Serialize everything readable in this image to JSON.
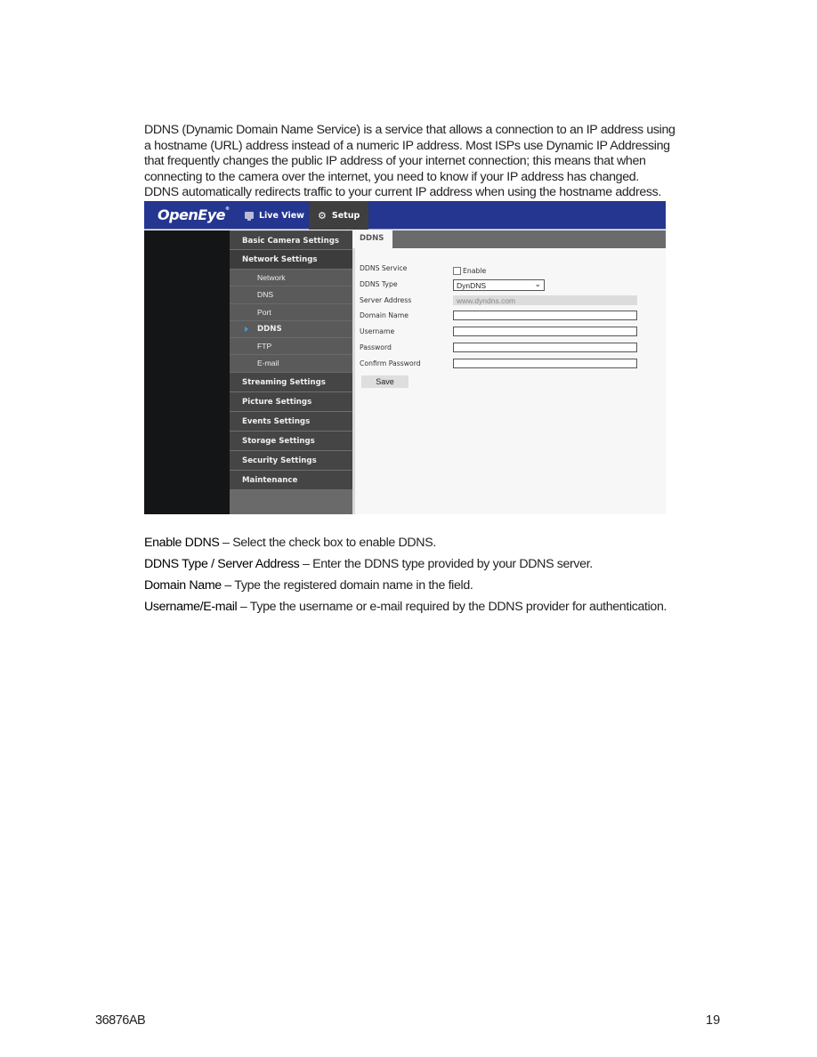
{
  "intro": {
    "lines": [
      "DDNS (Dynamic Domain Name Service) is a service that allows a connection to an IP address using",
      "a hostname (URL) address instead of a numeric IP address. Most ISPs use Dynamic IP Addressing",
      "that frequently changes the public IP address of your internet connection; this means that when",
      "connecting to the camera over the internet, you need to know if your IP address has changed.",
      "DDNS automatically redirects traffic to your current IP address when using the hostname address."
    ]
  },
  "screenshot": {
    "brand": "OpenEye",
    "brand_mark": "®",
    "colors": {
      "header": "#24368f",
      "active_tab": "#3f3f3f",
      "marker": "#3aa0e0"
    },
    "nav": [
      {
        "label": "Live View",
        "icon": "monitor-icon"
      },
      {
        "label": "Setup",
        "icon": "gear-icon",
        "active": true
      }
    ],
    "page_tab": "DDNS",
    "sidebar": {
      "sections": [
        {
          "label": "Basic Camera Settings"
        },
        {
          "label": "Network Settings",
          "expanded": true,
          "items": [
            {
              "label": "Network"
            },
            {
              "label": "DNS"
            },
            {
              "label": "Port"
            },
            {
              "label": "DDNS",
              "active": true
            },
            {
              "label": "FTP"
            },
            {
              "label": "E-mail"
            }
          ]
        },
        {
          "label": "Streaming Settings"
        },
        {
          "label": "Picture Settings"
        },
        {
          "label": "Events Settings"
        },
        {
          "label": "Storage Settings"
        },
        {
          "label": "Security Settings"
        },
        {
          "label": "Maintenance"
        }
      ]
    },
    "form": {
      "ddns_service": {
        "label": "DDNS Service",
        "checkbox_label": "Enable",
        "checked": false
      },
      "ddns_type": {
        "label": "DDNS Type",
        "value": "DynDNS"
      },
      "server_address": {
        "label": "Server Address",
        "value": "www.dyndns.com"
      },
      "domain_name": {
        "label": "Domain Name",
        "value": ""
      },
      "username": {
        "label": "Username",
        "value": ""
      },
      "password": {
        "label": "Password",
        "value": ""
      },
      "confirm_password": {
        "label": "Confirm Password",
        "value": ""
      },
      "save_label": "Save"
    }
  },
  "descriptions": [
    {
      "term": "Enable DDNS",
      "text": " – Select the check box to enable DDNS."
    },
    {
      "term": "DDNS Type / Server Address",
      "text": " – Enter the DDNS type provided by your DDNS server."
    },
    {
      "term": "Domain Name",
      "text": " – Type the registered domain name in the field."
    },
    {
      "term": "Username/E-mail",
      "text": " – Type the username or e-mail required by the DDNS provider for authentication."
    }
  ],
  "footer": {
    "doc_number": "36876AB",
    "page_number": "19"
  }
}
